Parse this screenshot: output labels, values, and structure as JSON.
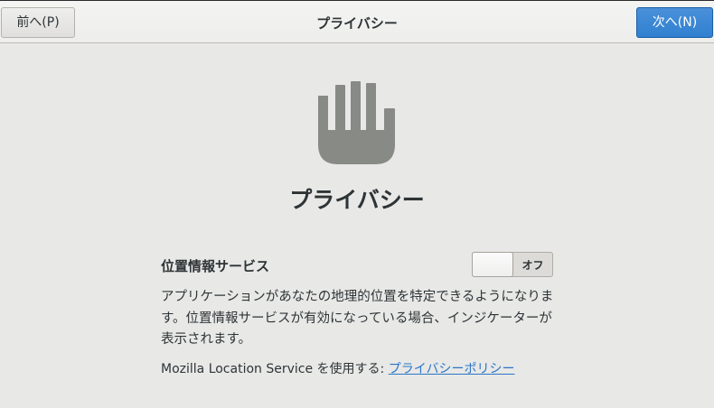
{
  "header": {
    "title": "プライバシー",
    "back_label": "前へ(P)",
    "next_label": "次へ(N)"
  },
  "main": {
    "icon": "hand-stop-icon",
    "title": "プライバシー",
    "location_setting": {
      "label": "位置情報サービス",
      "switch_state_text": "オフ",
      "enabled": false
    },
    "description": "アプリケーションがあなたの地理的位置を特定できるようになります。位置情報サービスが有効になっている場合、インジケーターが表示されます。",
    "mozilla_prefix": "Mozilla Location Service を使用する: ",
    "policy_link_text": "プライバシーポリシー"
  },
  "colors": {
    "accent": "#3584e4",
    "icon_gray": "#888a85",
    "link": "#2a76c6"
  }
}
